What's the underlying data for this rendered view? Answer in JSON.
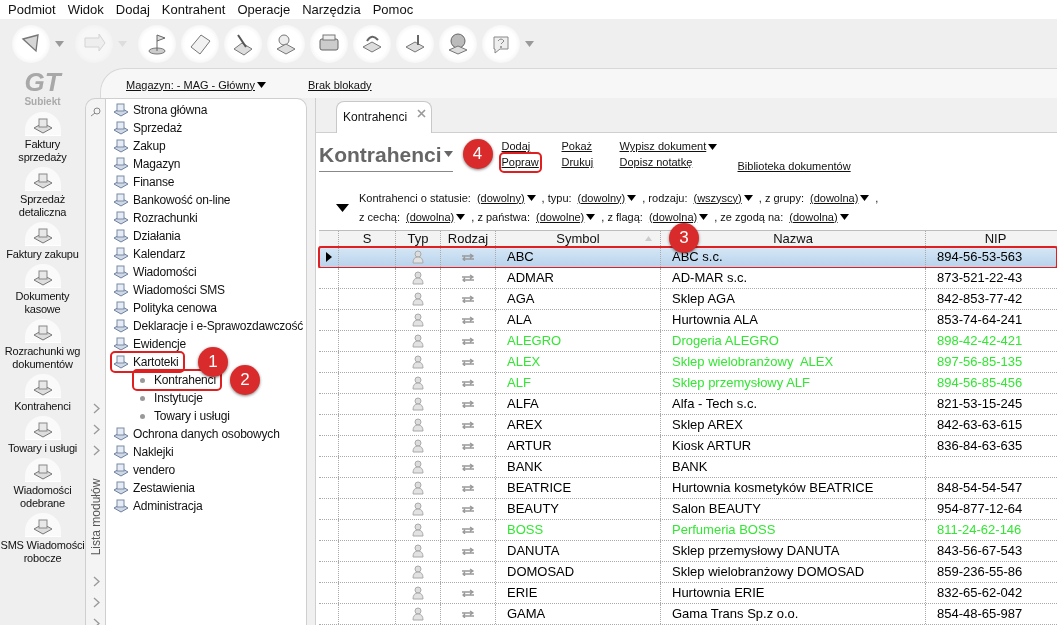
{
  "menu": [
    "Podmiot",
    "Widok",
    "Dodaj",
    "Kontrahent",
    "Operacje",
    "Narzędzia",
    "Pomoc"
  ],
  "toolbar": [
    {
      "dropdown": true,
      "disabled": false
    },
    {
      "dropdown": true,
      "disabled": true
    },
    {
      "dropdown": false,
      "disabled": false
    },
    {
      "dropdown": false,
      "disabled": false
    },
    {
      "dropdown": false,
      "disabled": false
    },
    {
      "dropdown": false,
      "disabled": false
    },
    {
      "dropdown": false,
      "disabled": false
    },
    {
      "dropdown": false,
      "disabled": false
    },
    {
      "dropdown": false,
      "disabled": false
    },
    {
      "dropdown": false,
      "disabled": false
    },
    {
      "dropdown": true,
      "disabled": false
    }
  ],
  "logo": {
    "mark": "GT",
    "name": "Subiekt"
  },
  "sidebar": {
    "items": [
      "Faktury sprzedaży",
      "Sprzedaż detaliczna",
      "Faktury zakupu",
      "Dokumenty kasowe",
      "Rozrachunki wg dokumentów",
      "Kontrahenci",
      "Towary i usługi",
      "Wiadomości odebrane",
      "SMS Wiadomości robocze"
    ]
  },
  "top_bar": {
    "warehouse": "Magazyn: - MAG - Główny",
    "lock": "Brak blokady"
  },
  "module_list": {
    "title": "Lista modułów",
    "items": [
      {
        "label": "Strona główna",
        "highlighted": false
      },
      {
        "label": "Sprzedaż",
        "highlighted": false
      },
      {
        "label": "Zakup",
        "highlighted": false
      },
      {
        "label": "Magazyn",
        "highlighted": false
      },
      {
        "label": "Finanse",
        "highlighted": false
      },
      {
        "label": "Bankowość on-line",
        "highlighted": false
      },
      {
        "label": "Rozrachunki",
        "highlighted": false
      },
      {
        "label": "Działania",
        "highlighted": false
      },
      {
        "label": "Kalendarz",
        "highlighted": false
      },
      {
        "label": "Wiadomości",
        "highlighted": false
      },
      {
        "label": "Wiadomości SMS",
        "highlighted": false
      },
      {
        "label": "Polityka cenowa",
        "highlighted": false
      },
      {
        "label": "Deklaracje i e-Sprawozdawczość",
        "highlighted": false
      },
      {
        "label": "Ewidencje",
        "highlighted": false
      },
      {
        "label": "Kartoteki",
        "highlighted": true,
        "marker": "1",
        "expanded": true,
        "children": [
          {
            "label": "Kontrahenci",
            "highlighted": true,
            "marker": "2"
          },
          {
            "label": "Instytucje",
            "highlighted": false
          },
          {
            "label": "Towary i usługi",
            "highlighted": false
          }
        ]
      },
      {
        "label": "Ochrona danych osobowych",
        "highlighted": false
      },
      {
        "label": "Naklejki",
        "highlighted": false
      },
      {
        "label": "vendero",
        "highlighted": false
      },
      {
        "label": "Zestawienia",
        "highlighted": false
      },
      {
        "label": "Administracja",
        "highlighted": false
      }
    ]
  },
  "tabs": [
    {
      "label": "Kontrahenci",
      "selected": true
    }
  ],
  "title": "Kontrahenci",
  "actions": [
    [
      {
        "label": "Dodaj",
        "dropdown": false,
        "highlighted": false
      },
      {
        "label": "Popraw",
        "dropdown": false,
        "highlighted": true,
        "marker": "4"
      }
    ],
    [
      {
        "label": "Pokaż",
        "dropdown": false,
        "highlighted": false
      },
      {
        "label": "Drukuj",
        "dropdown": false,
        "highlighted": false
      }
    ],
    [
      {
        "label": "Wypisz dokument",
        "dropdown": true,
        "highlighted": false
      },
      {
        "label": "Dopisz notatkę",
        "dropdown": false,
        "highlighted": false
      }
    ],
    [
      {
        "label": "Biblioteka dokumentów",
        "dropdown": false,
        "highlighted": false
      }
    ]
  ],
  "filters": [
    [
      {
        "label": "Kontrahenci o statusie:",
        "value": "(dowolny)"
      },
      {
        "label": ", typu:",
        "value": "(dowolny)"
      },
      {
        "label": ", rodzaju:",
        "value": "(wszyscy)"
      },
      {
        "label": ", z grupy:",
        "value": "(dowolna)"
      },
      {
        "label": ","
      }
    ],
    [
      {
        "label": "z cechą:",
        "value": "(dowolna)"
      },
      {
        "label": ", z państwa:",
        "value": "(dowolne)"
      },
      {
        "label": ", z flagą:",
        "value": "(dowolna)"
      },
      {
        "label": ", ze zgodą na:",
        "value": "(dowolna)"
      }
    ]
  ],
  "table": {
    "columns": [
      {
        "label": "S",
        "sorted": false
      },
      {
        "label": "Typ",
        "sorted": false
      },
      {
        "label": "Rodzaj",
        "sorted": false
      },
      {
        "label": "Symbol",
        "sorted": true
      },
      {
        "label": "Nazwa",
        "sorted": false,
        "marker": "3"
      },
      {
        "label": "NIP",
        "sorted": false
      }
    ],
    "rows": [
      {
        "symbol": "ABC",
        "name": "ABC s.c.",
        "nip": "894-56-53-563",
        "color": "#000000",
        "selected": true,
        "highlighted": true
      },
      {
        "symbol": "ADMAR",
        "name": "AD-MAR s.c.",
        "nip": "873-521-22-43",
        "color": "#000000",
        "selected": false,
        "highlighted": false
      },
      {
        "symbol": "AGA",
        "name": "Sklep AGA",
        "nip": "842-853-77-42",
        "color": "#000000",
        "selected": false,
        "highlighted": false
      },
      {
        "symbol": "ALA",
        "name": "Hurtownia ALA",
        "nip": "853-74-64-241",
        "color": "#000000",
        "selected": false,
        "highlighted": false
      },
      {
        "symbol": "ALEGRO",
        "name": "Drogeria ALEGRO",
        "nip": "898-42-42-421",
        "color": "#33e633",
        "selected": false,
        "highlighted": false
      },
      {
        "symbol": "ALEX",
        "name": "Sklep wielobranżowy  ALEX",
        "nip": "897-56-85-135",
        "color": "#33e633",
        "selected": false,
        "highlighted": false
      },
      {
        "symbol": "ALF",
        "name": "Sklep przemysłowy ALF",
        "nip": "894-56-85-456",
        "color": "#33e633",
        "selected": false,
        "highlighted": false
      },
      {
        "symbol": "ALFA",
        "name": "Alfa - Tech s.c.",
        "nip": "821-53-15-245",
        "color": "#000000",
        "selected": false,
        "highlighted": false
      },
      {
        "symbol": "AREX",
        "name": "Sklep AREX",
        "nip": "842-63-63-615",
        "color": "#000000",
        "selected": false,
        "highlighted": false
      },
      {
        "symbol": "ARTUR",
        "name": "Kiosk ARTUR",
        "nip": "836-84-63-635",
        "color": "#000000",
        "selected": false,
        "highlighted": false
      },
      {
        "symbol": "BANK",
        "name": "BANK",
        "color": "#000000",
        "selected": false,
        "highlighted": false
      },
      {
        "symbol": "BEATRICE",
        "name": "Hurtownia kosmetyków BEATRICE",
        "nip": "848-54-54-547",
        "color": "#000000",
        "selected": false,
        "highlighted": false
      },
      {
        "symbol": "BEAUTY",
        "name": "Salon BEAUTY",
        "nip": "954-877-12-64",
        "color": "#000000",
        "selected": false,
        "highlighted": false
      },
      {
        "symbol": "BOSS",
        "name": "Perfumeria BOSS",
        "nip": "811-24-62-146",
        "color": "#33e633",
        "selected": false,
        "highlighted": false
      },
      {
        "symbol": "DANUTA",
        "name": "Sklep przemysłowy DANUTA",
        "nip": "843-56-67-543",
        "color": "#000000",
        "selected": false,
        "highlighted": false
      },
      {
        "symbol": "DOMOSAD",
        "name": "Sklep wielobranżowy DOMOSAD",
        "nip": "859-236-55-86",
        "color": "#000000",
        "selected": false,
        "highlighted": false
      },
      {
        "symbol": "ERIE",
        "name": "Hurtownia ERIE",
        "nip": "832-65-62-042",
        "color": "#000000",
        "selected": false,
        "highlighted": false
      },
      {
        "symbol": "GAMA",
        "name": "Gama Trans Sp.z o.o.",
        "nip": "854-48-65-987",
        "color": "#000000",
        "selected": false,
        "highlighted": false
      }
    ]
  }
}
